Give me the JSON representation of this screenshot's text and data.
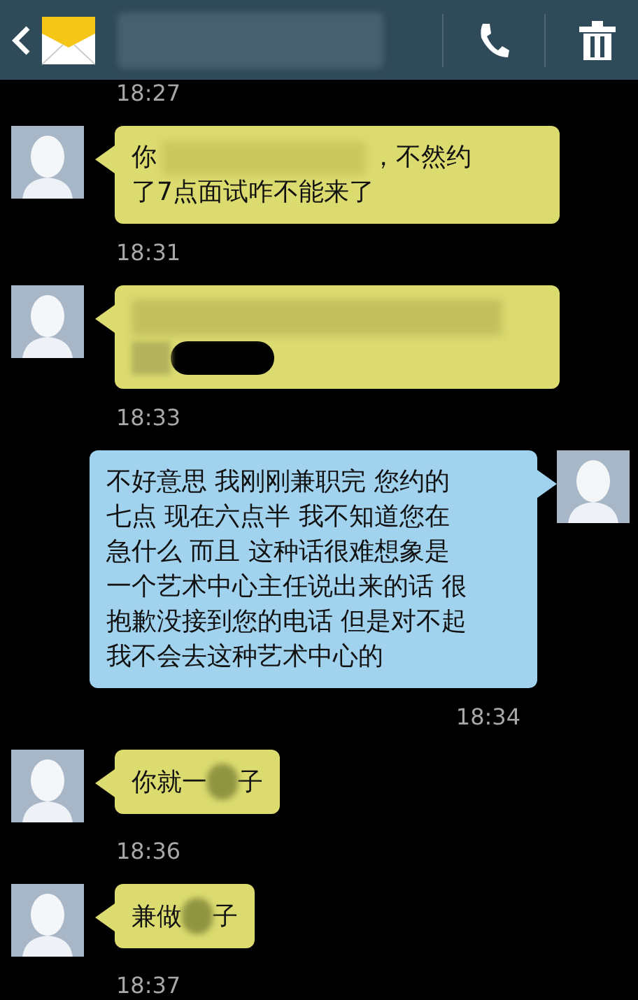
{
  "messages": [
    {
      "kind": "incoming",
      "time_before": "18:27",
      "lines": [
        [
          {
            "kind": "text",
            "text": "你"
          },
          {
            "kind": "blur"
          },
          {
            "kind": "text",
            "text": "，不然约"
          }
        ],
        [
          {
            "kind": "text",
            "text": "了7点面试咋不能来了"
          }
        ]
      ],
      "time": "18:31"
    },
    {
      "kind": "incoming",
      "lines": [
        [
          {
            "kind": "blur_wide"
          }
        ],
        [
          {
            "kind": "blur_short"
          },
          {
            "kind": "blackout"
          }
        ]
      ],
      "time": "18:33"
    },
    {
      "kind": "outgoing",
      "lines": [
        [
          {
            "kind": "text",
            "text": "不好意思 我刚刚兼职完 您约的"
          }
        ],
        [
          {
            "kind": "text",
            "text": "七点 现在六点半 我不知道您在"
          }
        ],
        [
          {
            "kind": "text",
            "text": "急什么 而且 这种话很难想象是"
          }
        ],
        [
          {
            "kind": "text",
            "text": "一个艺术中心主任说出来的话 很"
          }
        ],
        [
          {
            "kind": "text",
            "text": "抱歉没接到您的电话 但是对不起"
          }
        ],
        [
          {
            "kind": "text",
            "text": "我不会去这种艺术中心的"
          }
        ]
      ],
      "time": "18:34"
    },
    {
      "kind": "incoming",
      "lines": [
        [
          {
            "kind": "text",
            "text": "你就一"
          },
          {
            "kind": "blur_char"
          },
          {
            "kind": "text",
            "text": "子"
          }
        ]
      ],
      "time": "18:36"
    },
    {
      "kind": "incoming",
      "lines": [
        [
          {
            "kind": "text",
            "text": "兼做"
          },
          {
            "kind": "blur_char"
          },
          {
            "kind": "text",
            "text": "子"
          }
        ]
      ],
      "time": "18:37"
    }
  ]
}
